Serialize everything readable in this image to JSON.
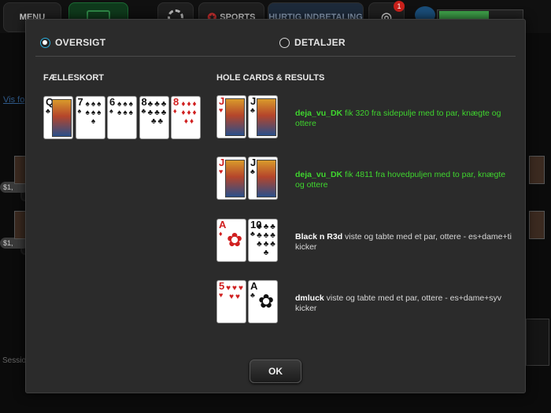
{
  "topbar": {
    "menu_label": "MENU",
    "sports_label": "SPORTS",
    "deposit_label": "HURTIG INDBETALING",
    "notification_count": "1",
    "progress_fraction": 0.58
  },
  "background": {
    "link_text": "Vis fo",
    "session_text": "Sessio",
    "seat_chips": [
      "$1,",
      "$1,"
    ]
  },
  "modal": {
    "tabs": [
      {
        "label": "OVERSIGT",
        "selected": true
      },
      {
        "label": "DETALJER",
        "selected": false
      }
    ],
    "board_title": "FÆLLESKORT",
    "hole_title": "HOLE CARDS & RESULTS",
    "board_cards": [
      {
        "rank": "Q",
        "suit": "♣",
        "color": "black"
      },
      {
        "rank": "7",
        "suit": "♠",
        "color": "black"
      },
      {
        "rank": "6",
        "suit": "♠",
        "color": "black"
      },
      {
        "rank": "8",
        "suit": "♣",
        "color": "black"
      },
      {
        "rank": "8",
        "suit": "♦",
        "color": "red"
      }
    ],
    "results": [
      {
        "cards": [
          {
            "rank": "J",
            "suit": "♥",
            "color": "red"
          },
          {
            "rank": "J",
            "suit": "♣",
            "color": "black"
          }
        ],
        "player": "deja_vu_DK",
        "text": " fik 320 fra sidepulje med to par, knægte og ottere",
        "winner": true
      },
      {
        "cards": [
          {
            "rank": "J",
            "suit": "♥",
            "color": "red"
          },
          {
            "rank": "J",
            "suit": "♣",
            "color": "black"
          }
        ],
        "player": "deja_vu_DK",
        "text": " fik 4811 fra hovedpuljen med to par, knægte og ottere",
        "winner": true
      },
      {
        "cards": [
          {
            "rank": "A",
            "suit": "♦",
            "color": "red"
          },
          {
            "rank": "10",
            "suit": "♣",
            "color": "black"
          }
        ],
        "player": "Black n R3d",
        "text": " viste og tabte med et par, ottere - es+dame+ti kicker",
        "winner": false
      },
      {
        "cards": [
          {
            "rank": "5",
            "suit": "♥",
            "color": "red"
          },
          {
            "rank": "A",
            "suit": "♣",
            "color": "black"
          }
        ],
        "player": "dmluck",
        "text": " viste og tabte med et par, ottere - es+dame+syv kicker",
        "winner": false
      }
    ],
    "ok_label": "OK"
  },
  "colors": {
    "winner_text": "#3fd62e",
    "loser_text": "#d8d8d8",
    "radio_accent": "#2bb0e0",
    "red_suit": "#d02020"
  }
}
